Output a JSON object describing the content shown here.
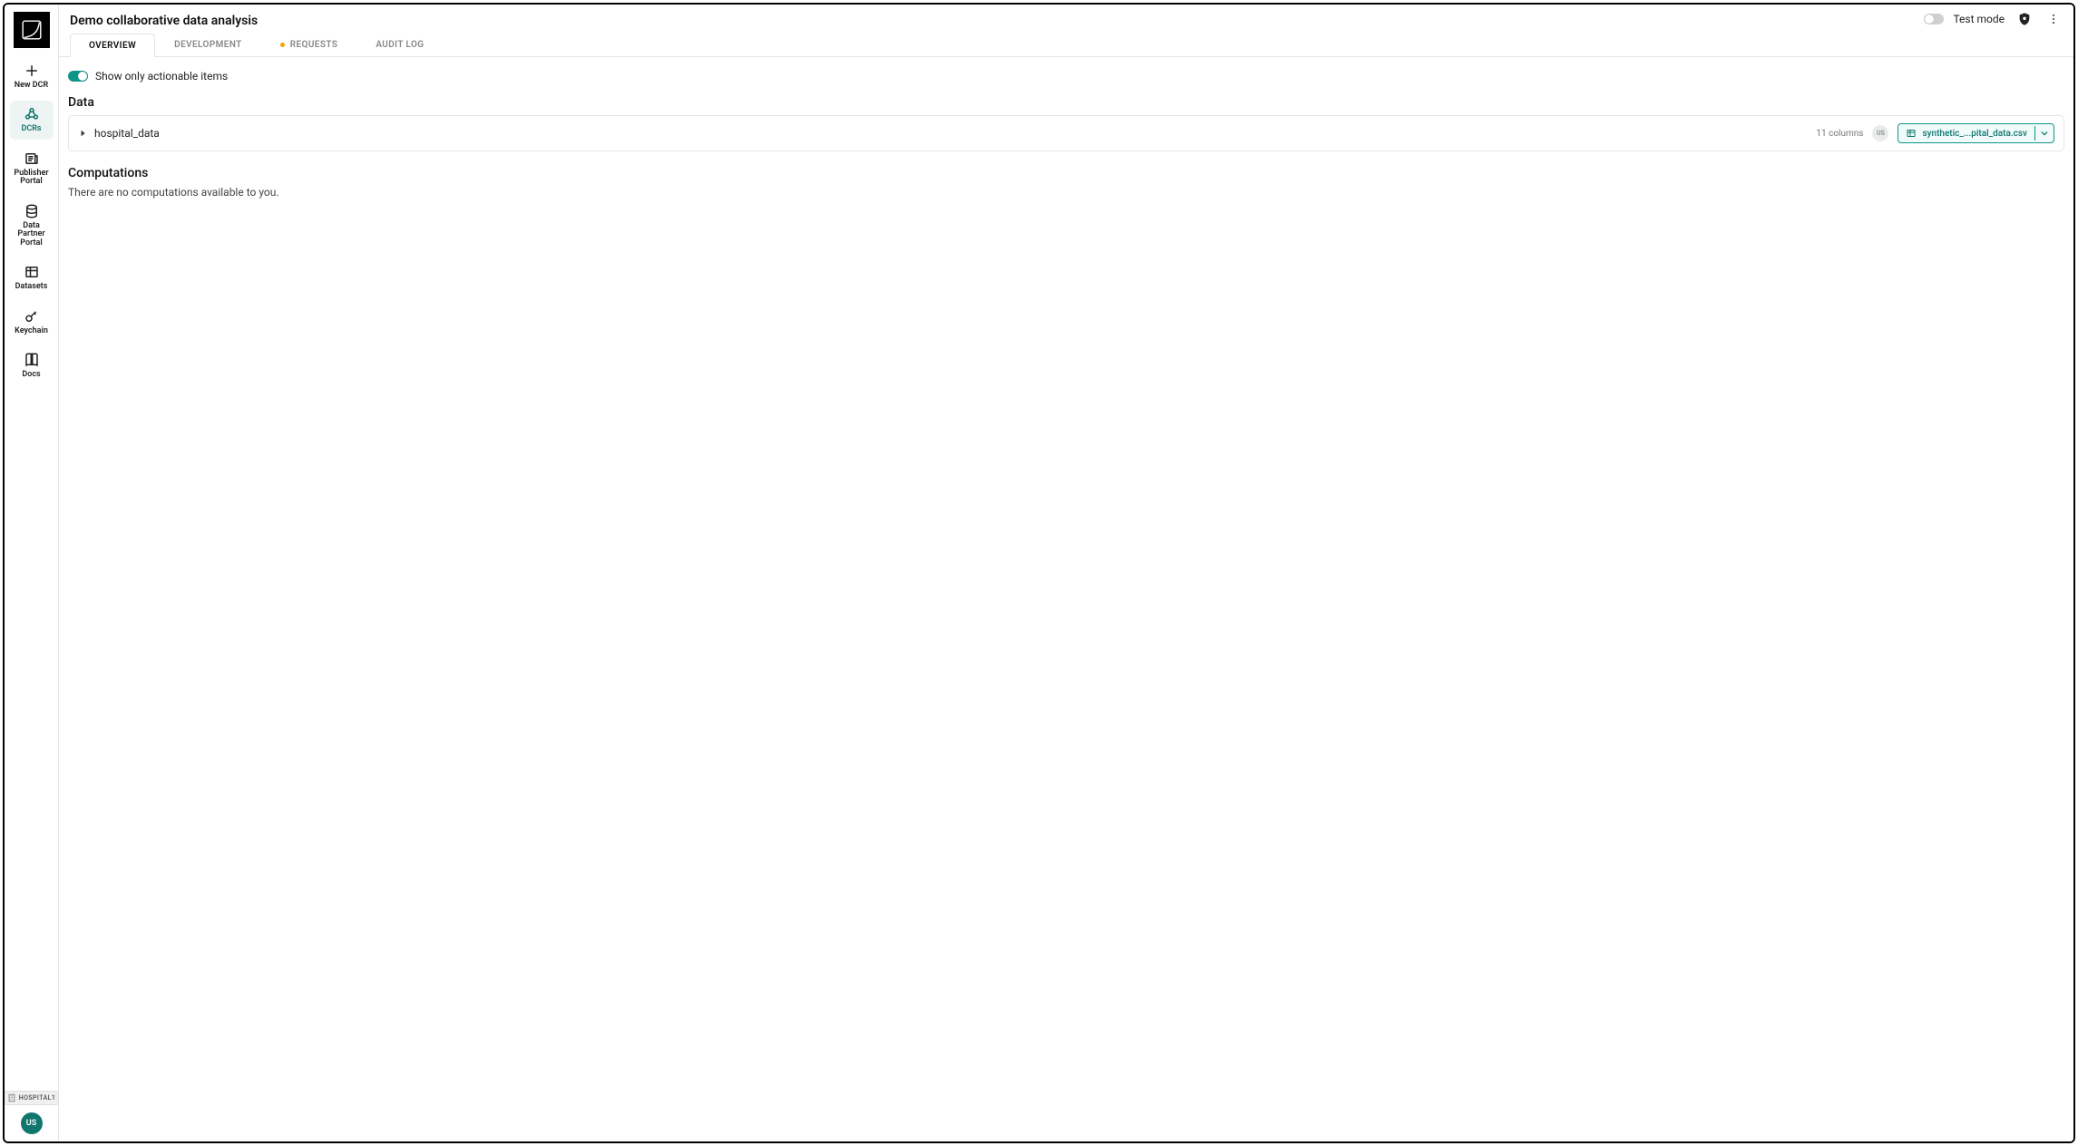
{
  "sidebar": {
    "items": [
      {
        "id": "new-dcr",
        "label": "New DCR"
      },
      {
        "id": "dcrs",
        "label": "DCRs"
      },
      {
        "id": "publisher-portal",
        "label": "Publisher Portal"
      },
      {
        "id": "data-partner-portal",
        "label": "Data Partner Portal"
      },
      {
        "id": "datasets",
        "label": "Datasets"
      },
      {
        "id": "keychain",
        "label": "Keychain"
      },
      {
        "id": "docs",
        "label": "Docs"
      }
    ],
    "orgLabel": "HOSPITAL1",
    "userInitials": "US"
  },
  "header": {
    "title": "Demo collaborative data analysis",
    "testModeLabel": "Test mode",
    "testModeOn": false
  },
  "tabs": [
    {
      "id": "overview",
      "label": "OVERVIEW",
      "active": true,
      "indicator": false
    },
    {
      "id": "development",
      "label": "DEVELOPMENT",
      "active": false,
      "indicator": false
    },
    {
      "id": "requests",
      "label": "REQUESTS",
      "active": false,
      "indicator": true
    },
    {
      "id": "audit-log",
      "label": "AUDIT LOG",
      "active": false,
      "indicator": false
    }
  ],
  "overview": {
    "actionableToggleLabel": "Show only actionable items",
    "actionableToggleOn": true,
    "dataHeading": "Data",
    "dataRows": [
      {
        "name": "hospital_data",
        "columnsText": "11 columns",
        "ownerInitials": "US",
        "fileLabel": "synthetic_...pital_data.csv"
      }
    ],
    "computationsHeading": "Computations",
    "computationsEmpty": "There are no computations available to you."
  }
}
